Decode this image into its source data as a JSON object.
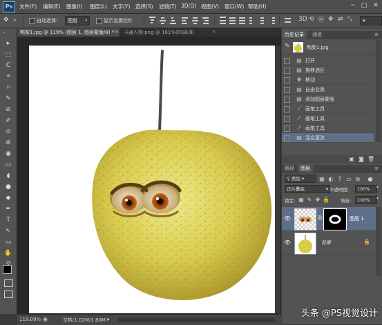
{
  "app": {
    "logo": "Ps"
  },
  "menu": [
    "文件(F)",
    "编辑(E)",
    "图像(I)",
    "图层(L)",
    "文字(Y)",
    "选择(S)",
    "滤镜(T)",
    "3D(D)",
    "视图(V)",
    "窗口(W)",
    "帮助(H)"
  ],
  "window_controls": {
    "minimize": "−",
    "restore": "□",
    "close": "✕"
  },
  "options": {
    "auto_select_label": "自动选择:",
    "auto_select_value": "图层",
    "show_transform_label": "显示变换控件"
  },
  "tabs": [
    {
      "label": "鸭梨1.jpg @ 119% (图层 1, 图层蒙版/8) *",
      "active": true
    },
    {
      "label": "卡通人物.png @ 161%(RGB/8)",
      "active": false
    }
  ],
  "tools": [
    "▸",
    "⬚",
    "ᑕ",
    "⌖",
    "⌗",
    "✎",
    "⊘",
    "✐",
    "⊙",
    "⊛",
    "◉",
    "▭",
    "◖",
    "●",
    "◆",
    "✒",
    "T",
    "↖",
    "▭",
    "✋",
    "⚲"
  ],
  "history": {
    "tab_history": "历史记录",
    "tab_channels": "通道",
    "snapshot_label": "鸭梨1.jpg",
    "items": [
      {
        "label": "打开",
        "icon": "doc-icon"
      },
      {
        "label": "拖移选区",
        "icon": "doc-icon"
      },
      {
        "label": "移动",
        "icon": "move-icon"
      },
      {
        "label": "自由变换",
        "icon": "doc-icon"
      },
      {
        "label": "添加图层蒙版",
        "icon": "doc-icon"
      },
      {
        "label": "画笔工具",
        "icon": "brush-icon"
      },
      {
        "label": "画笔工具",
        "icon": "brush-icon"
      },
      {
        "label": "画笔工具",
        "icon": "brush-icon"
      },
      {
        "label": "混合更改",
        "icon": "doc-icon",
        "selected": true
      }
    ]
  },
  "layers": {
    "tab_paths": "路径",
    "tab_layers": "图层",
    "filter_kind": "类型",
    "blend_mode": "正片叠底",
    "opacity_label": "不透明度:",
    "opacity_value": "100%",
    "lock_label": "锁定:",
    "fill_label": "填充:",
    "fill_value": "100%",
    "items": [
      {
        "name": "图层 1",
        "selected": true
      },
      {
        "name": "背景",
        "italic": true
      }
    ]
  },
  "status": {
    "zoom": "119.09%",
    "doc_info": "文档:1.02M/1.80M"
  },
  "watermark": "头条 @PS视觉设计",
  "colors": {
    "accent_selected": "#5f6f89",
    "menubar": "#4e4e4e",
    "panel": "#535353",
    "pear": "#d7cd4a"
  }
}
